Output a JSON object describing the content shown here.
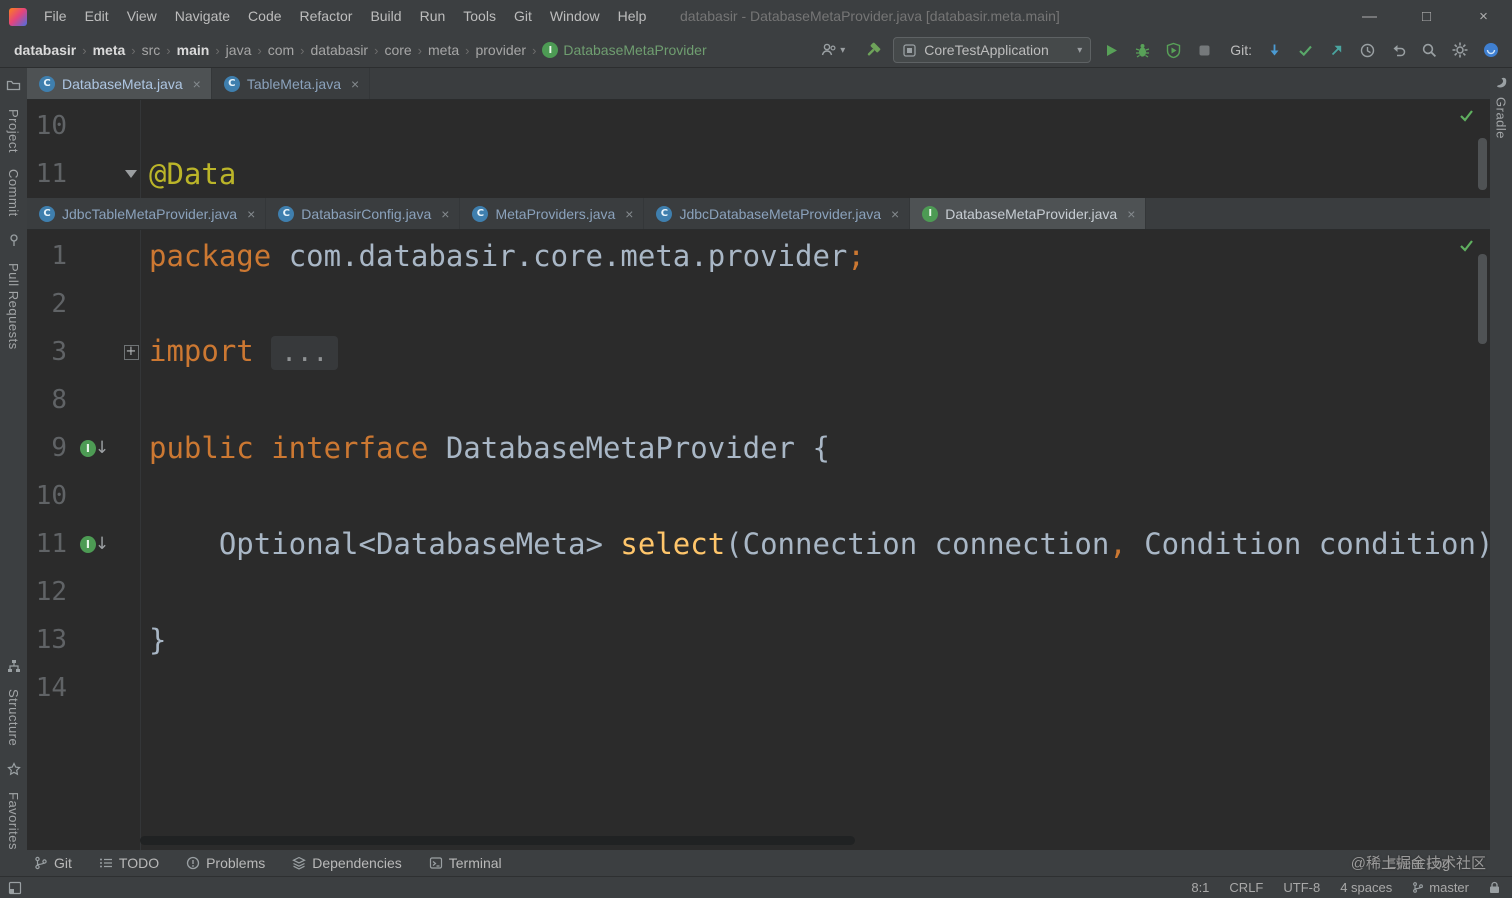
{
  "title_bar": {
    "menus": [
      "File",
      "Edit",
      "View",
      "Navigate",
      "Code",
      "Refactor",
      "Build",
      "Run",
      "Tools",
      "Git",
      "Window",
      "Help"
    ],
    "window_title": "databasir - DatabaseMetaProvider.java [databasir.meta.main]",
    "controls": {
      "minimize": "—",
      "maximize": "□",
      "close": "×"
    }
  },
  "nav_bar": {
    "separator": "›",
    "breadcrumbs": [
      "databasir",
      "meta",
      "src",
      "main",
      "java",
      "com",
      "databasir",
      "core",
      "meta",
      "provider",
      "DatabaseMetaProvider"
    ],
    "run_config": "CoreTestApplication",
    "git_label": "Git:"
  },
  "icons": {
    "class_letter": "C",
    "interface_letter": "I",
    "close": "×",
    "down_arrow": "↓",
    "plus": "+",
    "dropdown": "▾"
  },
  "editors": {
    "top": {
      "tabs": [
        {
          "label": "DatabaseMeta.java",
          "icon": "class",
          "selected": true
        },
        {
          "label": "TableMeta.java",
          "icon": "class",
          "selected": false
        }
      ],
      "lines": [
        {
          "num": "10",
          "tokens": []
        },
        {
          "num": "11",
          "fold": "open",
          "tokens": [
            {
              "type": "annotation",
              "text": "@Data"
            }
          ]
        }
      ]
    },
    "bottom": {
      "tabs": [
        {
          "label": "JdbcTableMetaProvider.java",
          "icon": "class",
          "selected": false
        },
        {
          "label": "DatabasirConfig.java",
          "icon": "class",
          "selected": false
        },
        {
          "label": "MetaProviders.java",
          "icon": "class",
          "selected": false
        },
        {
          "label": "JdbcDatabaseMetaProvider.java",
          "icon": "class",
          "selected": false
        },
        {
          "label": "DatabaseMetaProvider.java",
          "icon": "interface",
          "selected": true
        }
      ],
      "lines": [
        {
          "num": "1",
          "tokens": [
            {
              "type": "keyword",
              "text": "package "
            },
            {
              "type": "plain",
              "text": "com.databasir.core.meta.provider"
            },
            {
              "type": "keyword",
              "text": ";"
            }
          ]
        },
        {
          "num": "2",
          "tokens": []
        },
        {
          "num": "3",
          "fold": "plus",
          "tokens": [
            {
              "type": "keyword",
              "text": "import "
            },
            {
              "type": "folded",
              "text": "..."
            }
          ]
        },
        {
          "num": "8",
          "tokens": []
        },
        {
          "num": "9",
          "gutter": "implemented",
          "tokens": [
            {
              "type": "keyword",
              "text": "public interface "
            },
            {
              "type": "plain",
              "text": "DatabaseMetaProvider {"
            }
          ]
        },
        {
          "num": "10",
          "tokens": []
        },
        {
          "num": "11",
          "gutter": "implemented",
          "tokens": [
            {
              "type": "plain",
              "text": "    Optional<DatabaseMeta> "
            },
            {
              "type": "method",
              "text": "select"
            },
            {
              "type": "plain",
              "text": "(Connection connection"
            },
            {
              "type": "keyword",
              "text": ","
            },
            {
              "type": "plain",
              "text": " Condition condition);"
            }
          ]
        },
        {
          "num": "12",
          "tokens": []
        },
        {
          "num": "13",
          "tokens": [
            {
              "type": "plain",
              "text": "}"
            }
          ]
        },
        {
          "num": "14",
          "tokens": []
        }
      ]
    }
  },
  "left_stripe": {
    "top": [
      "Project",
      "Commit",
      "Pull Requests"
    ],
    "bottom": [
      "Structure",
      "Favorites"
    ]
  },
  "right_stripe": {
    "items": [
      "Gradle"
    ]
  },
  "bottom_bar": {
    "items": [
      "Git",
      "TODO",
      "Problems",
      "Dependencies",
      "Terminal"
    ],
    "event_log": "Event Log"
  },
  "status_bar": {
    "caret": "8:1",
    "line_separator": "CRLF",
    "encoding": "UTF-8",
    "indent": "4 spaces",
    "branch": "master"
  },
  "watermark": "@稀土掘金技术社区"
}
